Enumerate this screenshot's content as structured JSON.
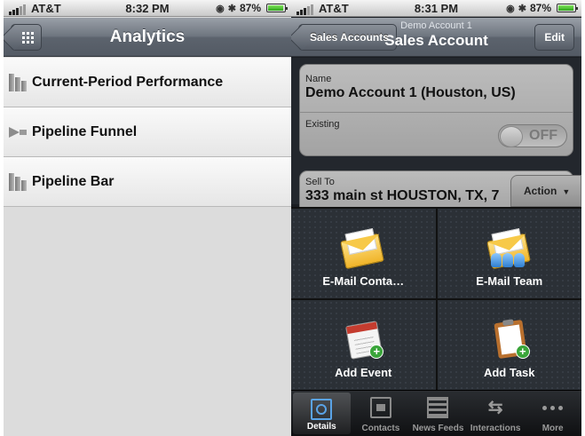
{
  "left": {
    "status": {
      "carrier": "AT&T",
      "time": "8:32 PM",
      "battery": "87%"
    },
    "nav": {
      "title": "Analytics"
    },
    "list": [
      {
        "label": "Current-Period Performance",
        "icon": "bar-chart-icon"
      },
      {
        "label": "Pipeline Funnel",
        "icon": "funnel-icon"
      },
      {
        "label": "Pipeline Bar",
        "icon": "bar-chart-icon"
      }
    ]
  },
  "right": {
    "status": {
      "carrier": "AT&T",
      "time": "8:31 PM",
      "battery": "87%"
    },
    "nav": {
      "back_label": "Sales Accounts",
      "subtitle": "Demo Account 1",
      "title": "Sales Account",
      "edit_label": "Edit"
    },
    "fields": {
      "name_label": "Name",
      "name_value": "Demo Account 1 (Houston, US)",
      "existing_label": "Existing",
      "existing_toggle": "OFF",
      "sellto_label": "Sell To",
      "sellto_value": "333 main st HOUSTON, TX, 7"
    },
    "action_label": "Action",
    "actions": [
      {
        "label": "E-Mail Conta…",
        "icon": "email-contact-icon"
      },
      {
        "label": "E-Mail Team",
        "icon": "email-team-icon"
      },
      {
        "label": "Add Event",
        "icon": "add-event-icon"
      },
      {
        "label": "Add Task",
        "icon": "add-task-icon"
      }
    ],
    "tabs": [
      {
        "label": "Details",
        "icon": "details-icon",
        "active": true
      },
      {
        "label": "Contacts",
        "icon": "contacts-icon"
      },
      {
        "label": "News Feeds",
        "icon": "news-feeds-icon"
      },
      {
        "label": "Interactions",
        "icon": "interactions-icon"
      },
      {
        "label": "More",
        "icon": "more-icon"
      }
    ]
  }
}
